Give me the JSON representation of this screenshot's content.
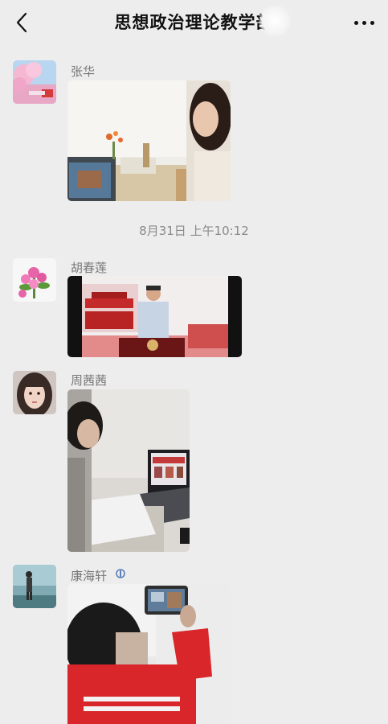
{
  "header": {
    "title": "思想政治理论教学部",
    "back_icon": "chevron-left-icon",
    "more_icon": "more-dots-icon"
  },
  "messages": [
    {
      "sender": "张华",
      "type": "image"
    },
    {
      "sender": "胡春莲",
      "type": "image"
    },
    {
      "sender": "周茜茜",
      "type": "image"
    },
    {
      "sender": "康海轩",
      "type": "image"
    }
  ],
  "timestamp": "8月31日 上午10:12",
  "colors": {
    "background": "#ededed",
    "title": "#111111",
    "name": "#777777",
    "timestamp": "#8a8a8a"
  }
}
